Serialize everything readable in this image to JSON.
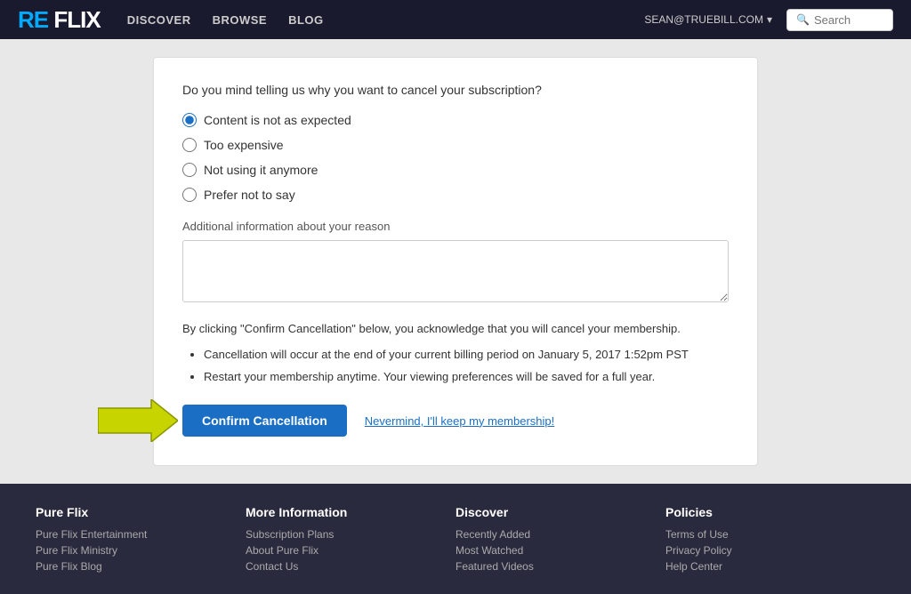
{
  "header": {
    "logo_prefix": "RE",
    "logo_suffix": " FLIX",
    "nav": [
      "DISCOVER",
      "BROWSE",
      "BLOG"
    ],
    "user_email": "SEAN@TRUEBILL.COM",
    "search_placeholder": "Search"
  },
  "cancel_form": {
    "question": "Do you mind telling us why you want to cancel your subscription?",
    "options": [
      {
        "label": "Content is not as expected",
        "selected": true
      },
      {
        "label": "Too expensive",
        "selected": false
      },
      {
        "label": "Not using it anymore",
        "selected": false
      },
      {
        "label": "Prefer not to say",
        "selected": false
      }
    ],
    "additional_label": "Additional information about your reason",
    "acknowledgment": "By clicking \"Confirm Cancellation\" below, you acknowledge that you will cancel your membership.",
    "bullets": [
      "Cancellation will occur at the end of your current billing period on January 5, 2017 1:52pm PST",
      "Restart your membership anytime. Your viewing preferences will be saved for a full year."
    ],
    "confirm_button": "Confirm Cancellation",
    "keep_link": "Nevermind, I'll keep my membership!"
  },
  "footer": {
    "columns": [
      {
        "title": "Pure Flix",
        "links": [
          "Pure Flix Entertainment",
          "Pure Flix Ministry",
          "Pure Flix Blog"
        ]
      },
      {
        "title": "More Information",
        "links": [
          "Subscription Plans",
          "About Pure Flix",
          "Contact Us"
        ]
      },
      {
        "title": "Discover",
        "links": [
          "Recently Added",
          "Most Watched",
          "Featured Videos"
        ]
      },
      {
        "title": "Policies",
        "links": [
          "Terms of Use",
          "Privacy Policy",
          "Help Center"
        ]
      }
    ]
  }
}
